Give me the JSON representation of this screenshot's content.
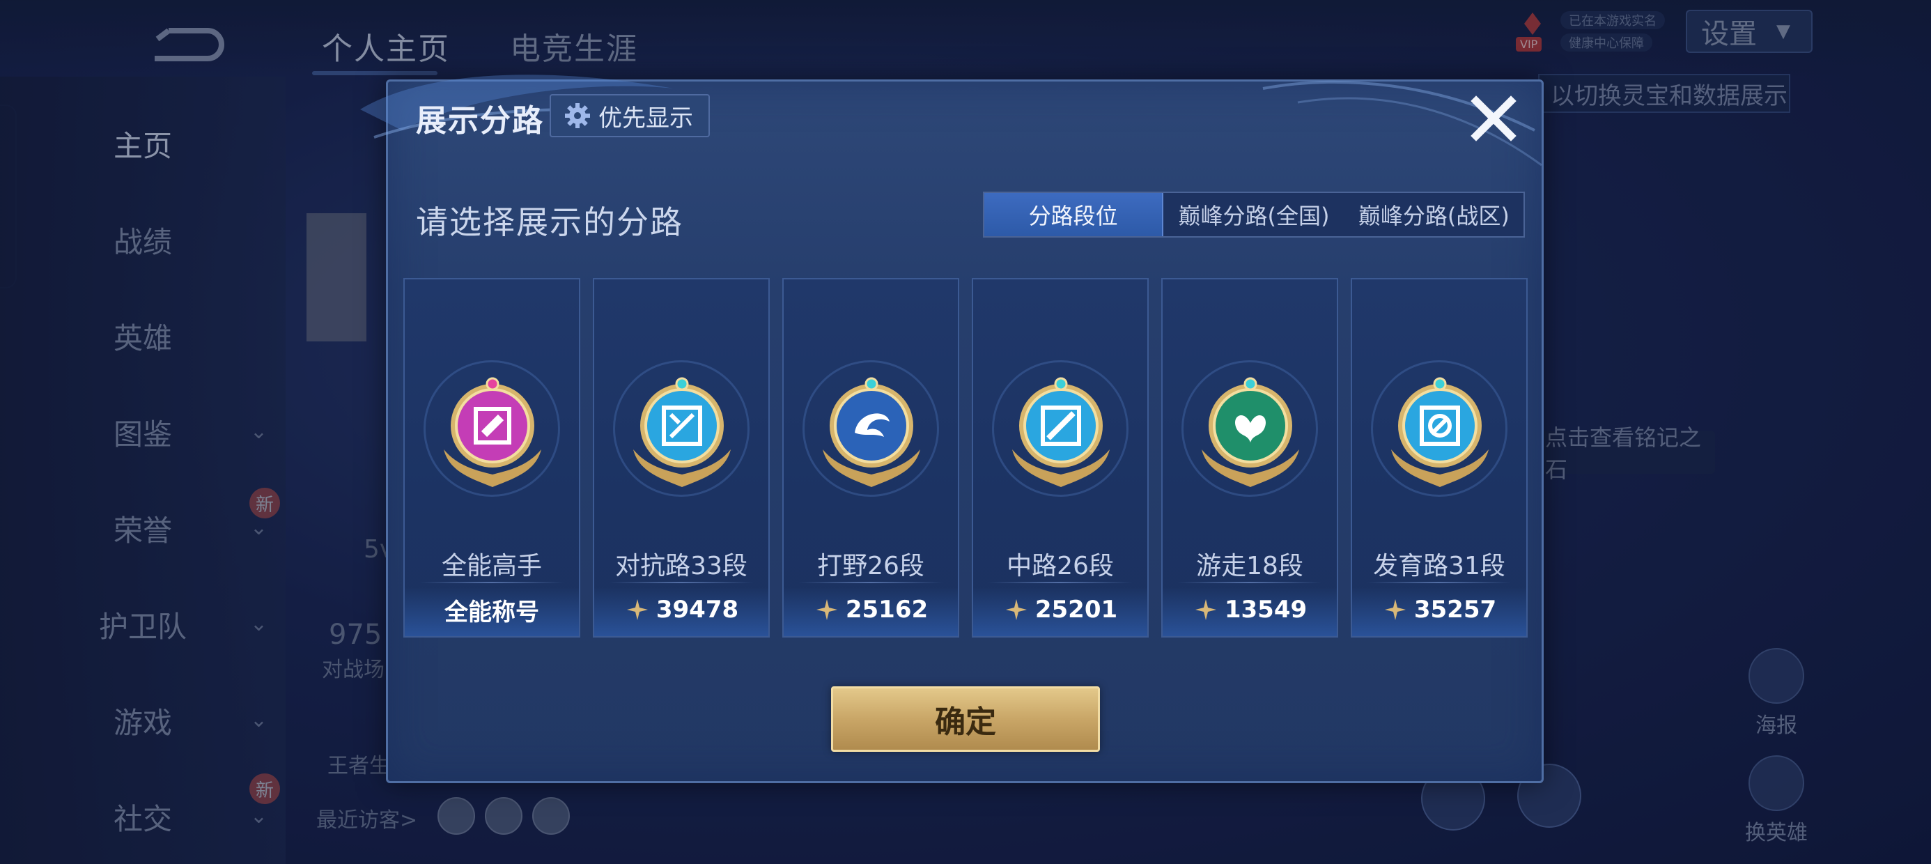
{
  "background": {
    "top_tabs": [
      "个人主页",
      "电竞生涯"
    ],
    "sidebar_items": [
      {
        "label": "主页",
        "has_chevron": false
      },
      {
        "label": "战绩",
        "has_chevron": false
      },
      {
        "label": "英雄",
        "has_chevron": false
      },
      {
        "label": "图鉴",
        "has_chevron": true
      },
      {
        "label": "荣誉",
        "has_chevron": true,
        "badge": "新"
      },
      {
        "label": "护卫队",
        "has_chevron": true
      },
      {
        "label": "游戏",
        "has_chevron": true
      },
      {
        "label": "社交",
        "has_chevron": true,
        "badge": "新"
      }
    ],
    "settings_label": "设置",
    "vip_label": "VIP",
    "pills": [
      "已在本游戏实名",
      "健康中心保障"
    ],
    "hint_top": "以切换灵宝和数据展示",
    "hint_mid": "点击查看铭记之石",
    "right_buttons": [
      "海报",
      "换英雄"
    ],
    "bg_texts": {
      "a": "5v",
      "b": "975",
      "c": "对战场",
      "d": "王者生"
    },
    "visitors_label": "最近访客>"
  },
  "modal": {
    "title": "展示分路",
    "priority_label": "优先显示",
    "prompt": "请选择展示的分路",
    "tabs": [
      "分路段位",
      "巅峰分路(全国)",
      "巅峰分路(战区)"
    ],
    "active_tab": 0,
    "cards": [
      {
        "name": "全能高手",
        "value": "全能称号",
        "has_icon": false,
        "emblem": "all-round",
        "color": "#c43db6"
      },
      {
        "name": "对抗路33段",
        "value": "39478",
        "has_icon": true,
        "emblem": "clash-lane",
        "color": "#2aa6e0"
      },
      {
        "name": "打野26段",
        "value": "25162",
        "has_icon": true,
        "emblem": "jungle",
        "color": "#2b63b8"
      },
      {
        "name": "中路26段",
        "value": "25201",
        "has_icon": true,
        "emblem": "mid-lane",
        "color": "#2aa6e0"
      },
      {
        "name": "游走18段",
        "value": "13549",
        "has_icon": true,
        "emblem": "roam",
        "color": "#1f8f6a"
      },
      {
        "name": "发育路31段",
        "value": "35257",
        "has_icon": true,
        "emblem": "farm-lane",
        "color": "#2aa6e0"
      }
    ],
    "confirm_label": "确定",
    "colors": {
      "accent_blue": "#3d6bc0",
      "gold": "#d2b06f"
    }
  }
}
